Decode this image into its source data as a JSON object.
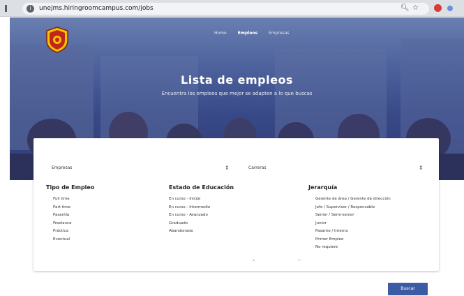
{
  "browser": {
    "url": "unejms.hiringroomcampus.com/jobs",
    "zoom_icon": "zoom-icon",
    "star_icon": "star-icon"
  },
  "hero": {
    "nav": [
      "Home",
      "Empleos",
      "Empresas"
    ],
    "title": "Lista de empleos",
    "subtitle": "Encuentra los empleos que mejor se adapten a lo que buscas"
  },
  "filters": {
    "company_select": "Empresas",
    "career_select": "Carreras",
    "employment_type": {
      "title": "Tipo de Empleo",
      "items": [
        "Full time",
        "Part time",
        "Pasantía",
        "Freelance",
        "Práctica",
        "Eventual"
      ]
    },
    "education_status": {
      "title": "Estado de Educación",
      "items": [
        "En curso - Inicial",
        "En curso - Intermedio",
        "En curso - Avanzado",
        "Graduado",
        "Abandonado"
      ]
    },
    "hierarchy": {
      "title": "Jerarquía",
      "items": [
        "Gerente de área / Gerente de dirección",
        "Jefe / Supervisor / Responsable",
        "Senior / Semi-senior",
        "Junior",
        "Pasante / Interno",
        "Primer Empleo",
        "No requiere"
      ]
    }
  },
  "search_button": "Buscar"
}
